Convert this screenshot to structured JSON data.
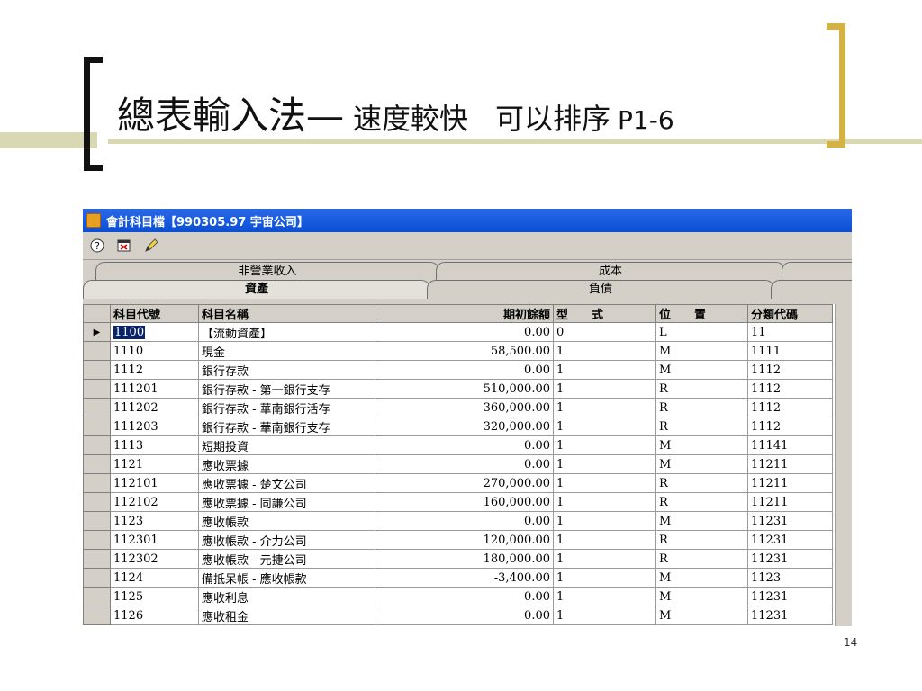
{
  "slide": {
    "title_main": "總表輸入法—",
    "title_sub": "速度較快",
    "title_sub2": "可以排序",
    "title_ref": "P1-6",
    "page_number": "14"
  },
  "window": {
    "title": "會計科目檔【990305.97 宇宙公司】"
  },
  "toolbar": {
    "buttons": [
      {
        "name": "help-icon",
        "glyph": "?"
      },
      {
        "name": "close-window-icon",
        "glyph": "⊠"
      },
      {
        "name": "edit-pencil-icon",
        "glyph": "✎"
      }
    ]
  },
  "tabs_top": [
    "非營業收入",
    "成本"
  ],
  "tabs_bottom": [
    "資產",
    "負債"
  ],
  "table": {
    "columns": [
      "科目代號",
      "科目名稱",
      "期初餘額",
      "型　　式",
      "位　　置",
      "分類代碼"
    ],
    "rows": [
      [
        "1100",
        "【流動資產】",
        "0.00",
        "0",
        "L",
        "11"
      ],
      [
        "1110",
        "現金",
        "58,500.00",
        "1",
        "M",
        "1111"
      ],
      [
        "1112",
        "銀行存款",
        "0.00",
        "1",
        "M",
        "1112"
      ],
      [
        "111201",
        "銀行存款 - 第一銀行支存",
        "510,000.00",
        "1",
        "R",
        "1112"
      ],
      [
        "111202",
        "銀行存款 - 華南銀行活存",
        "360,000.00",
        "1",
        "R",
        "1112"
      ],
      [
        "111203",
        "銀行存款 - 華南銀行支存",
        "320,000.00",
        "1",
        "R",
        "1112"
      ],
      [
        "1113",
        "短期投資",
        "0.00",
        "1",
        "M",
        "11141"
      ],
      [
        "1121",
        "應收票據",
        "0.00",
        "1",
        "M",
        "11211"
      ],
      [
        "112101",
        "應收票據 - 楚文公司",
        "270,000.00",
        "1",
        "R",
        "11211"
      ],
      [
        "112102",
        "應收票據 - 同謙公司",
        "160,000.00",
        "1",
        "R",
        "11211"
      ],
      [
        "1123",
        "應收帳款",
        "0.00",
        "1",
        "M",
        "11231"
      ],
      [
        "112301",
        "應收帳款 - 介力公司",
        "120,000.00",
        "1",
        "R",
        "11231"
      ],
      [
        "112302",
        "應收帳款 - 元捷公司",
        "180,000.00",
        "1",
        "R",
        "11231"
      ],
      [
        "1124",
        "備抵呆帳 - 應收帳款",
        "-3,400.00",
        "1",
        "M",
        "1123"
      ],
      [
        "1125",
        "應收利息",
        "0.00",
        "1",
        "M",
        "11231"
      ],
      [
        "1126",
        "應收租金",
        "0.00",
        "1",
        "M",
        "11231"
      ]
    ],
    "current_row_marker": "▶"
  }
}
